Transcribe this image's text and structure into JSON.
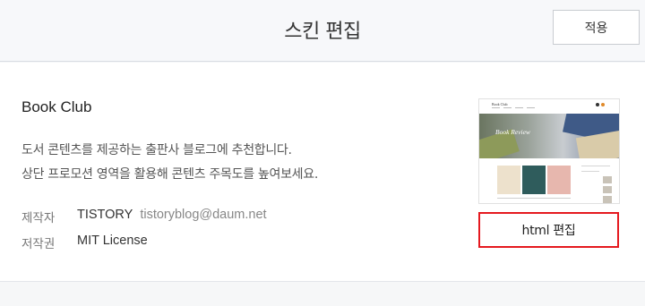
{
  "header": {
    "title": "스킨 편집",
    "apply_label": "적용"
  },
  "skin": {
    "name": "Book Club",
    "description": [
      "도서 콘텐츠를 제공하는 출판사 블로그에 추천합니다.",
      "상단 프로모션 영역을 활용해 콘텐츠 주목도를 높여보세요."
    ],
    "author_label": "제작자",
    "author_name": "TISTORY",
    "author_email": "tistoryblog@daum.net",
    "license_label": "저작권",
    "license_value": "MIT License"
  },
  "thumbnail": {
    "logo_text": "Book Club",
    "banner_text": "Book Review"
  },
  "actions": {
    "html_edit_label": "html 편집"
  },
  "colors": {
    "highlight_border": "#e5191f",
    "header_bg": "#f7f8fa",
    "page_bg": "#f6f7f8"
  }
}
